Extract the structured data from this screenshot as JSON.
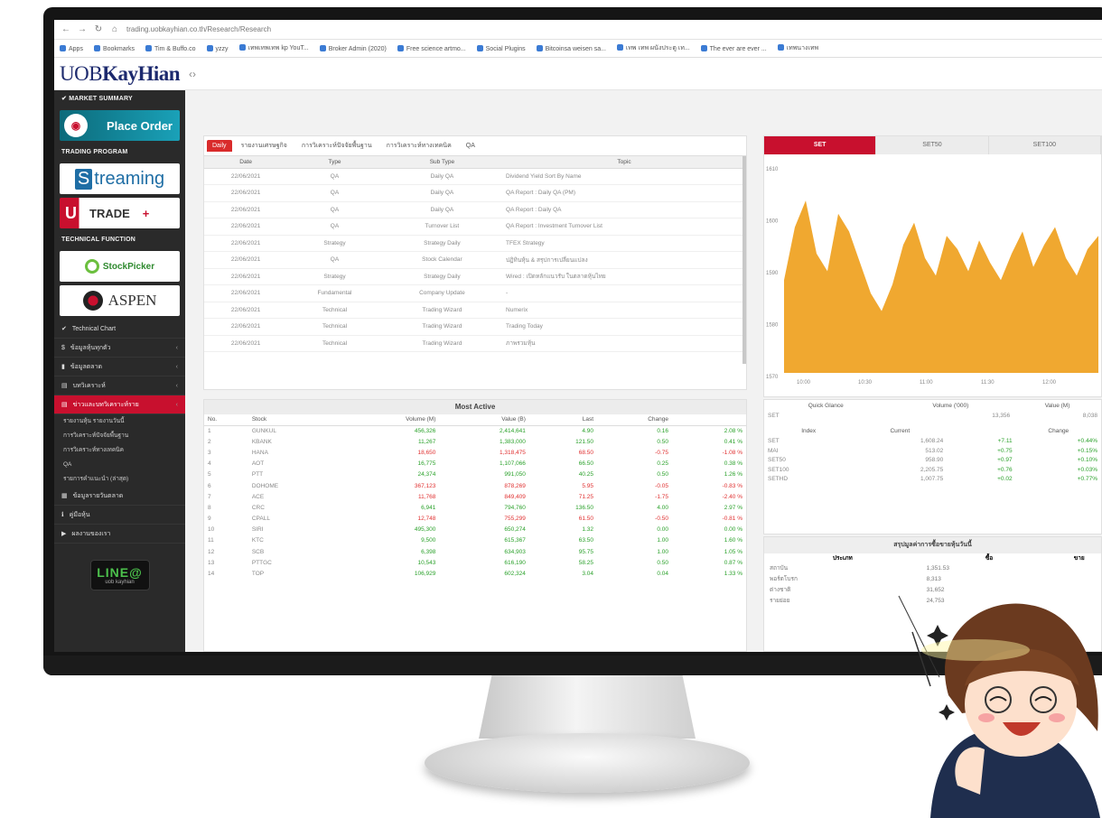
{
  "browser": {
    "url": "trading.uobkayhian.co.th/Research/Research",
    "bookmarks": [
      "Apps",
      "Bookmarks",
      "Tim & Buffo.co",
      "yzzy",
      "เทพเทพเทพ kp YouT...",
      "Broker Admin (2020)",
      "Free science artmo...",
      "Social Plugins",
      "Bitcoinsa weisen sa...",
      "เทพ เทพ ผนังประตู เท...",
      "The ever are ever ...",
      "เทพนางเทพ"
    ]
  },
  "app": {
    "logo_prefix": "UOB",
    "logo_name": "KayHian"
  },
  "sidebar": {
    "market_summary": "MARKET SUMMARY",
    "place_order": "Place Order",
    "trading_program": "TRADING PROGRAM",
    "streaming": "treaming",
    "streaming_s": "S",
    "trade": "TRADE",
    "technical_function": "TECHNICAL FUNCTION",
    "efficient": "StockPicker",
    "aspen": "ASPEN",
    "menu": [
      {
        "label": "Technical Chart",
        "icon": "chart-icon"
      },
      {
        "label": "ข้อมูลหุ้นทุกตัว",
        "icon": "dollar-icon"
      },
      {
        "label": "ข้อมูลตลาด",
        "icon": "bar-icon"
      },
      {
        "label": "บทวิเคราะห์",
        "icon": "doc-icon"
      },
      {
        "label": "ข่าวและบทวิเคราะห์ราย",
        "icon": "doc-icon"
      }
    ],
    "submenu": [
      "รายงานหุ้น รายงานวันนี้",
      "การวิเคราะห์ปัจจัยพื้นฐาน",
      "การวิเคราะห์ทางเทคนิค",
      "QA",
      "รายการคำแนะนำ (ล่าสุด)"
    ],
    "bottom": [
      {
        "label": "ข้อมูลรายวันตลาด",
        "icon": "calendar-icon"
      },
      {
        "label": "คู่มือหุ้น",
        "icon": "info-icon"
      },
      {
        "label": "ผลงานของเรา",
        "icon": "play-icon"
      }
    ],
    "line_badge": "LINE@",
    "line_sub": "uob kayhian"
  },
  "research": {
    "tabs": [
      "Daily",
      "รายงานเศรษฐกิจ",
      "การวิเคราะห์ปัจจัยพื้นฐาน",
      "การวิเคราะห์ทางเทคนิค",
      "QA"
    ],
    "headers": [
      "Date",
      "Type",
      "Sub Type",
      "Topic"
    ],
    "rows": [
      [
        "22/06/2021",
        "QA",
        "Daily QA",
        "Dividend Yield Sort By Name"
      ],
      [
        "22/06/2021",
        "QA",
        "Daily QA",
        "QA Report : Daily QA (PM)"
      ],
      [
        "22/06/2021",
        "QA",
        "Daily QA",
        "QA Report : Daily QA"
      ],
      [
        "22/06/2021",
        "QA",
        "Turnover List",
        "QA Report : Investment Turnover List"
      ],
      [
        "22/06/2021",
        "Strategy",
        "Strategy Daily",
        "TFEX Strategy"
      ],
      [
        "22/06/2021",
        "QA",
        "Stock Calendar",
        "ปฏิทินหุ้น & สรุปการเปลี่ยนแปลง"
      ],
      [
        "22/06/2021",
        "Strategy",
        "Strategy Daily",
        "Wired : เปิดหลักแนวรับ ในตลาดหุ้นไทย"
      ],
      [
        "22/06/2021",
        "Fundamental",
        "Company Update",
        "-"
      ],
      [
        "22/06/2021",
        "Technical",
        "Trading Wizard",
        "Numerix"
      ],
      [
        "22/06/2021",
        "Technical",
        "Trading Wizard",
        "Trading Today"
      ],
      [
        "22/06/2021",
        "Technical",
        "Trading Wizard",
        "ภาพรวมหุ้น"
      ]
    ]
  },
  "most_active": {
    "title": "Most Active",
    "headers": [
      "No.",
      "Stock",
      "Volume (M)",
      "Value (B)",
      "Last",
      "Change",
      ""
    ],
    "rows": [
      [
        "1",
        "GUNKUL",
        "456,326",
        "2,414,641",
        "4.90",
        "0.16",
        "2.08 %",
        "up"
      ],
      [
        "2",
        "KBANK",
        "11,267",
        "1,383,000",
        "121.50",
        "0.50",
        "0.41 %",
        "up"
      ],
      [
        "3",
        "HANA",
        "18,650",
        "1,318,475",
        "68.50",
        "-0.75",
        "-1.08 %",
        "down"
      ],
      [
        "4",
        "AOT",
        "16,775",
        "1,107,066",
        "66.50",
        "0.25",
        "0.38 %",
        "up"
      ],
      [
        "5",
        "PTT",
        "24,374",
        "991,050",
        "40.25",
        "0.50",
        "1.26 %",
        "up"
      ],
      [
        "6",
        "DOHOME",
        "367,123",
        "878,269",
        "5.95",
        "-0.05",
        "-0.83 %",
        "down"
      ],
      [
        "7",
        "ACE",
        "11,768",
        "849,409",
        "71.25",
        "-1.75",
        "-2.40 %",
        "down"
      ],
      [
        "8",
        "CRC",
        "6,941",
        "794,760",
        "136.50",
        "4.00",
        "2.97 %",
        "up"
      ],
      [
        "9",
        "CPALL",
        "12,748",
        "755,299",
        "61.50",
        "-0.50",
        "-0.81 %",
        "down"
      ],
      [
        "10",
        "SIRI",
        "495,300",
        "650,274",
        "1.32",
        "0.00",
        "0.00 %",
        "up"
      ],
      [
        "11",
        "KTC",
        "9,500",
        "615,367",
        "63.50",
        "1.00",
        "1.60 %",
        "up"
      ],
      [
        "12",
        "SCB",
        "6,398",
        "634,903",
        "95.75",
        "1.00",
        "1.05 %",
        "up"
      ],
      [
        "13",
        "PTTGC",
        "10,543",
        "616,190",
        "58.25",
        "0.50",
        "0.87 %",
        "up"
      ],
      [
        "14",
        "TOP",
        "106,929",
        "602,324",
        "3.04",
        "0.04",
        "1.33 %",
        "up"
      ]
    ]
  },
  "chart": {
    "tabs": [
      "SET",
      "SET50",
      "SET100"
    ],
    "y_ticks": [
      "1610",
      "1600",
      "1590",
      "1580",
      "1570"
    ],
    "x_ticks": [
      "10:00",
      "10:30",
      "11:00",
      "11:30",
      "12:00"
    ],
    "color": "#f0a830"
  },
  "chart_data": {
    "type": "area",
    "series": [
      {
        "name": "SET",
        "values": [
          1586,
          1598,
          1604,
          1592,
          1588,
          1601,
          1597,
          1590,
          1583,
          1579,
          1585,
          1594,
          1599,
          1591,
          1587,
          1596,
          1593,
          1588,
          1595,
          1590,
          1586,
          1592,
          1597,
          1589,
          1594,
          1598,
          1591,
          1587,
          1593,
          1596
        ]
      }
    ],
    "ylim": [
      1565,
      1612
    ]
  },
  "glance": {
    "headers": [
      "Quick Glance",
      "Volume ('000)",
      "Value (M)"
    ],
    "rows": [
      [
        "SET",
        "13,356",
        "8,038"
      ]
    ],
    "index_headers": [
      "Index",
      "Current",
      "",
      "Change"
    ],
    "index_rows": [
      [
        "SET",
        "1,608.24",
        "+7.11",
        "+0.44%"
      ],
      [
        "MAI",
        "513.02",
        "+0.75",
        "+0.15%"
      ],
      [
        "SET50",
        "958.90",
        "+0.97",
        "+0.10%"
      ],
      [
        "SET100",
        "2,205.75",
        "+0.76",
        "+0.03%"
      ],
      [
        "SETHD",
        "1,007.75",
        "+0.02",
        "+0.77%"
      ]
    ]
  },
  "summary": {
    "title": "สรุปมูลค่าการซื้อขายหุ้นวันนี้",
    "headers": [
      "ประเภท",
      "ซื้อ",
      "ขาย"
    ],
    "rows": [
      [
        "สถาบัน",
        "1,351.53",
        ""
      ],
      [
        "พอร์ตโบรก",
        "8,313",
        ""
      ],
      [
        "ต่างชาติ",
        "31,652",
        ""
      ],
      [
        "รายย่อย",
        "24,753",
        ""
      ]
    ]
  }
}
